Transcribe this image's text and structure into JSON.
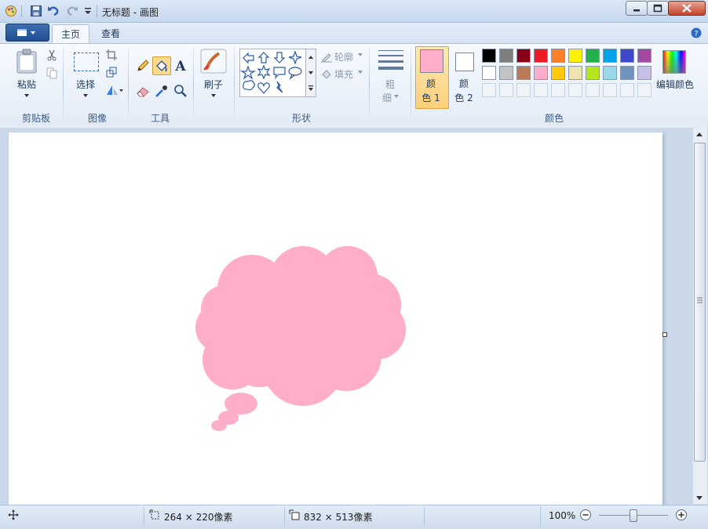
{
  "window": {
    "title": "无标题 - 画图"
  },
  "tabs": [
    {
      "label": "主页",
      "active": true
    },
    {
      "label": "查看",
      "active": false
    }
  ],
  "help_icon": "help-icon",
  "groups": {
    "clipboard": {
      "label": "剪贴板",
      "paste_label": "粘贴"
    },
    "image": {
      "label": "图像",
      "select_label": "选择"
    },
    "tools": {
      "label": "工具"
    },
    "brushes": {
      "label": "刷子"
    },
    "shapes": {
      "label": "形状",
      "outline_label": "轮廓",
      "fill_label": "填充"
    },
    "size": {
      "label_top": "粗",
      "label_bottom": "细"
    },
    "colors": {
      "label": "颜色",
      "color1_label_top": "颜",
      "color1_label_bottom": "色 1",
      "color2_label_top": "颜",
      "color2_label_bottom": "色 2",
      "edit_label": "编辑颜色",
      "color1": "#ffaec9",
      "color2": "#ffffff",
      "palette_row1": [
        "#000000",
        "#7f7f7f",
        "#880015",
        "#ed1c24",
        "#ff7f27",
        "#fff200",
        "#22b14c",
        "#00a2e8",
        "#3f48cc",
        "#a349a4"
      ],
      "palette_row2": [
        "#ffffff",
        "#c3c3c3",
        "#b97a57",
        "#ffaec9",
        "#ffc90e",
        "#efe4b0",
        "#b5e61d",
        "#99d9ea",
        "#7092be",
        "#c8bfe7"
      ]
    }
  },
  "canvas": {
    "shape_color": "#ffaec9"
  },
  "status": {
    "selection_size": "264 × 220像素",
    "canvas_size": "832 × 513像素",
    "zoom": "100%"
  }
}
